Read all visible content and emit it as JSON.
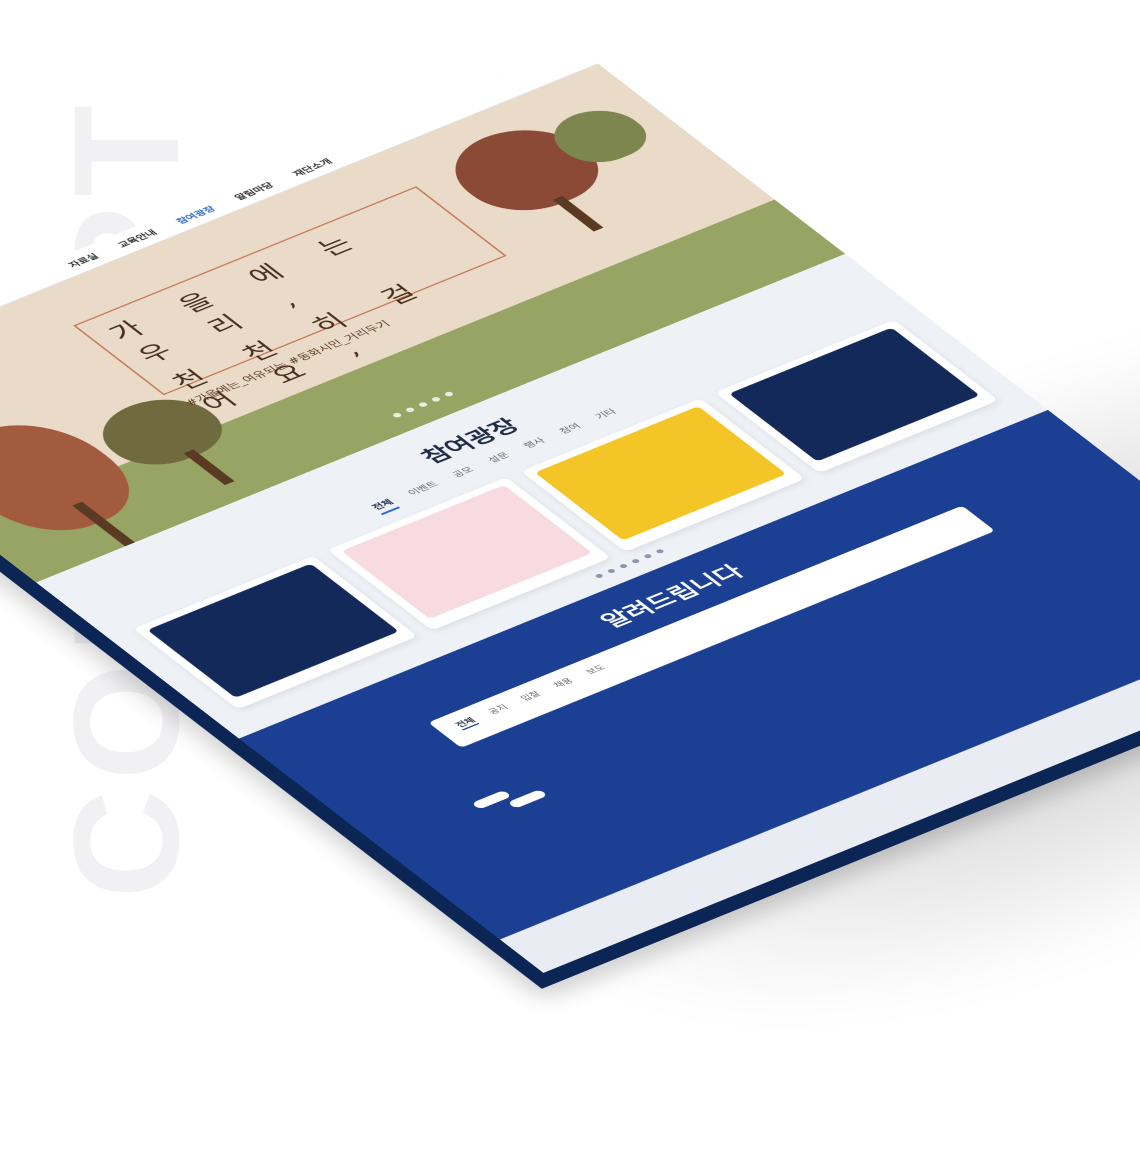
{
  "background_word": "CONCEPT",
  "header": {
    "logo_text": "",
    "nav": [
      "자료실",
      "교육안내",
      "참여광장",
      "알림마당",
      "재단소개"
    ],
    "active_index": 2,
    "top_right": []
  },
  "hero": {
    "line1": "가 을 에 는 우 리 ,",
    "line2": "천 천 히 걸 어 요 ,",
    "hashtags": "#가을에는_여유되는 #동화시민_거리두기"
  },
  "plaza": {
    "title": "참여광장",
    "tabs": [
      "전체",
      "이벤트",
      "공모",
      "설문",
      "행사",
      "참여",
      "기타"
    ],
    "active_tab": 0,
    "cards": [
      {
        "headline": "",
        "badge": "",
        "desc": ""
      },
      {
        "headline": "",
        "badge": "",
        "desc": ""
      },
      {
        "headline": "",
        "badge": "",
        "desc": ""
      },
      {
        "headline": "",
        "badge": "",
        "desc": ""
      }
    ]
  },
  "notice": {
    "title": "알려드립니다",
    "tabs": [
      "전체",
      "공지",
      "입찰",
      "채용",
      "보도"
    ],
    "active_tab": 0,
    "items": []
  },
  "colors": {
    "navy": "#0b2555",
    "accent": "#2b68c8",
    "hero_bg": "#eadbc9",
    "ground": "#97a464",
    "notice_bg": "#1b3f93"
  }
}
